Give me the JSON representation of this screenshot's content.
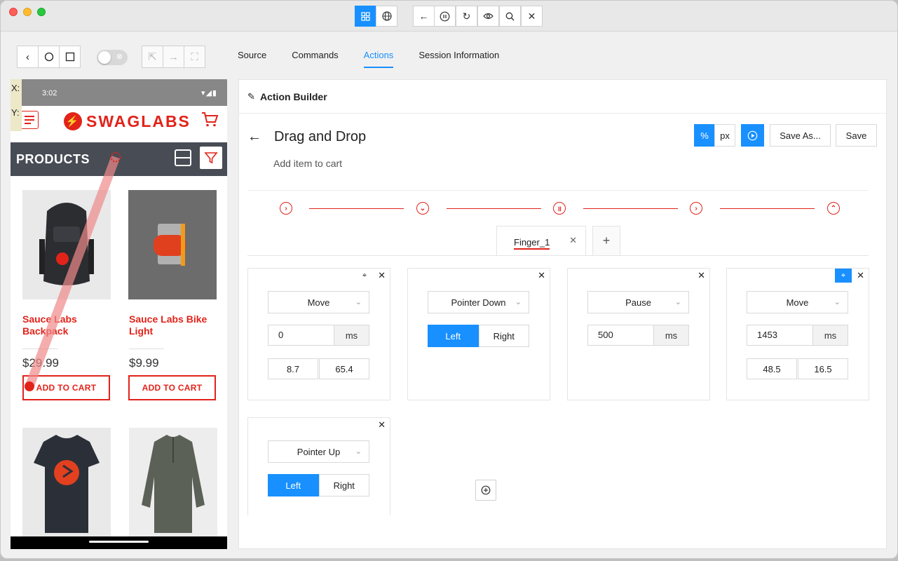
{
  "titlebar": {
    "buttons": [
      "grid-icon",
      "globe-icon",
      "back-arrow-icon",
      "pause-icon",
      "refresh-icon",
      "eye-icon",
      "search-icon",
      "close-icon"
    ]
  },
  "nav_tabs": [
    {
      "label": "Source"
    },
    {
      "label": "Commands"
    },
    {
      "label": "Actions"
    },
    {
      "label": "Session Information"
    }
  ],
  "device": {
    "time": "3:02",
    "x_label": "X:",
    "y_label": "Y:",
    "logo_text": "SWAGLABS",
    "products_title": "PRODUCTS",
    "products": [
      {
        "name": "Sauce Labs Backpack",
        "price": "$29.99",
        "button": "ADD TO CART"
      },
      {
        "name": "Sauce Labs Bike Light",
        "price": "$9.99",
        "button": "ADD TO CART"
      }
    ]
  },
  "action_builder": {
    "header": "Action Builder",
    "title": "Drag and Drop",
    "description": "Add item to cart",
    "unit_percent": "%",
    "unit_px": "px",
    "save_as": "Save As...",
    "save": "Save",
    "finger_tab": "Finger_1",
    "cards": [
      {
        "type": "Move",
        "duration": "0",
        "unit": "ms",
        "x": "8.7",
        "y": "65.4"
      },
      {
        "type": "Pointer Down",
        "left": "Left",
        "right": "Right"
      },
      {
        "type": "Pause",
        "duration": "500",
        "unit": "ms"
      },
      {
        "type": "Move",
        "duration": "1453",
        "unit": "ms",
        "x": "48.5",
        "y": "16.5"
      },
      {
        "type": "Pointer Up",
        "left": "Left",
        "right": "Right"
      }
    ]
  },
  "colors": {
    "accent": "#1890ff",
    "brand_red": "#e2231a"
  }
}
